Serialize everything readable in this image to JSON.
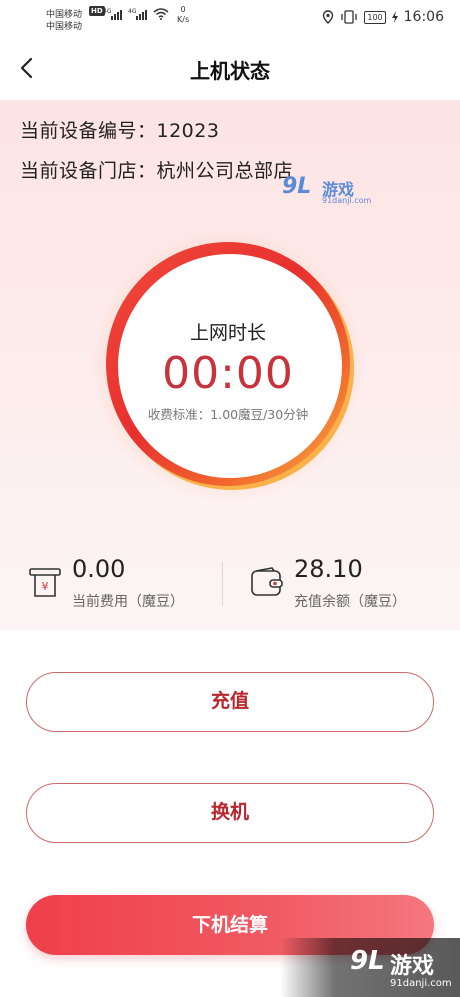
{
  "status_bar": {
    "carrier1": "中国移动",
    "carrier2": "中国移动",
    "hd": "HD",
    "net1": "4G",
    "net2": "4G",
    "speed_value": "0",
    "speed_unit": "K/s",
    "battery": "100",
    "time": "16:06"
  },
  "header": {
    "title": "上机状态"
  },
  "device": {
    "number_line": "当前设备编号：12023",
    "store_line": "当前设备门店：杭州公司总部店"
  },
  "timer": {
    "label": "上网时长",
    "value": "00:00",
    "rate": "收费标准：1.00魔豆/30分钟"
  },
  "stats": {
    "current_fee_value": "0.00",
    "current_fee_label": "当前费用（魔豆）",
    "balance_value": "28.10",
    "balance_label": "充值余额（魔豆）"
  },
  "buttons": {
    "recharge": "充值",
    "switch": "换机",
    "checkout": "下机结算"
  },
  "watermark": {
    "logo": "9L",
    "name": "游戏",
    "url": "91danji.com"
  },
  "colors": {
    "accent": "#c8323a",
    "button_gradient_start": "#ef3f4a",
    "ring_red": "#e8302f",
    "ring_orange": "#f7a23a"
  }
}
